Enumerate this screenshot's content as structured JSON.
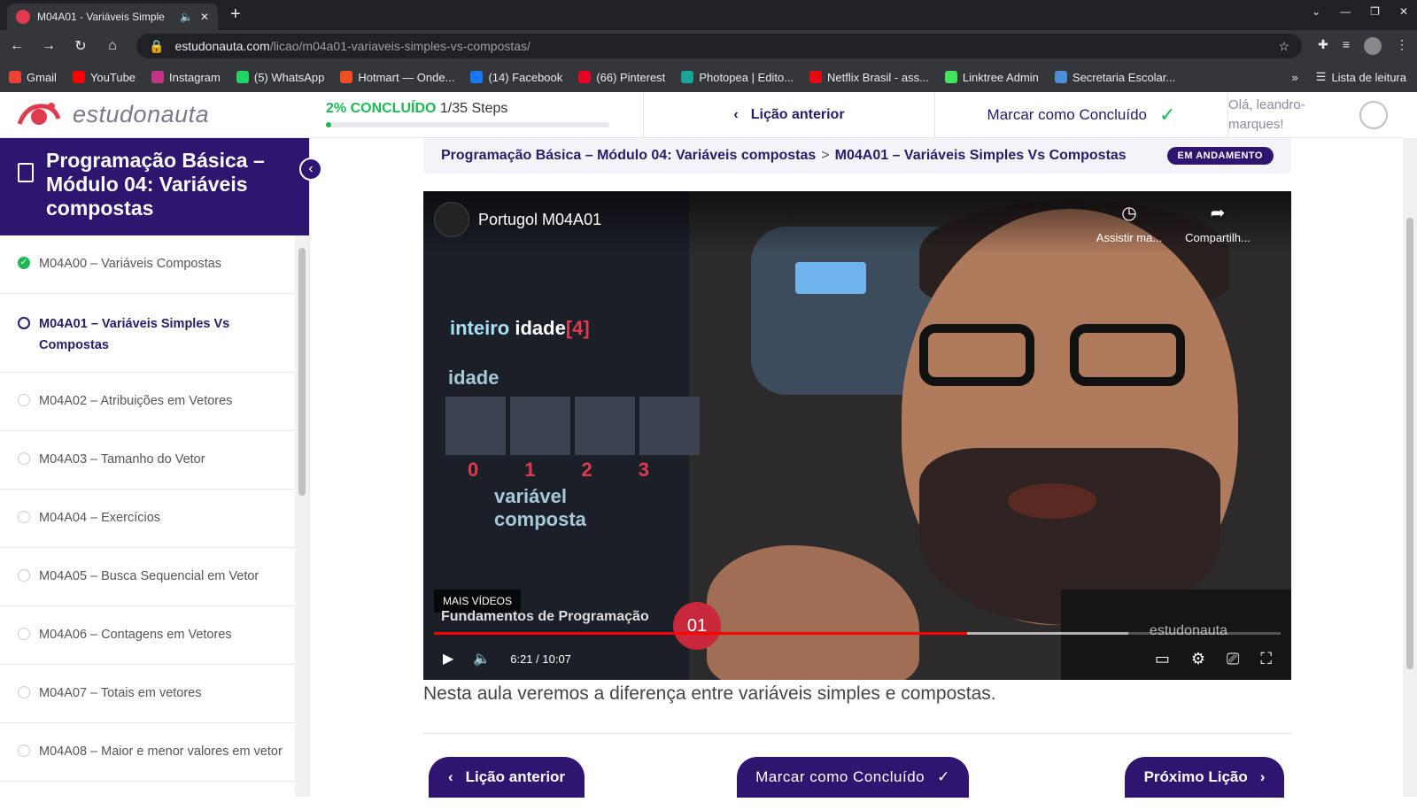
{
  "browser": {
    "tab_title": "M04A01 - Variáveis Simple",
    "url_host": "estudonauta.com",
    "url_path": "/licao/m04a01-variaveis-simples-vs-compostas/",
    "bookmarks": [
      {
        "label": "Gmail",
        "color": "#ea4335"
      },
      {
        "label": "YouTube",
        "color": "#ff0000"
      },
      {
        "label": "Instagram",
        "color": "#c13584"
      },
      {
        "label": "(5) WhatsApp",
        "color": "#25d366"
      },
      {
        "label": "Hotmart — Onde...",
        "color": "#f04e23"
      },
      {
        "label": "(14) Facebook",
        "color": "#1877f2"
      },
      {
        "label": "(66) Pinterest",
        "color": "#e60023"
      },
      {
        "label": "Photopea | Edito...",
        "color": "#18a497"
      },
      {
        "label": "Netflix Brasil - ass...",
        "color": "#e50914"
      },
      {
        "label": "Linktree Admin",
        "color": "#43e55e"
      },
      {
        "label": "Secretaria Escolar...",
        "color": "#4a8fd8"
      }
    ],
    "overflow": "»",
    "reading_list": "Lista de leitura"
  },
  "header": {
    "logo_text": "estudonauta",
    "progress_pct": "2% CONCLUÍDO",
    "progress_steps": "1/35 Steps",
    "progress_fraction": 0.02,
    "prev_label": "Lição anterior",
    "mark_label": "Marcar como Concluído",
    "greeting": "Olá, leandro-marques!"
  },
  "sidebar": {
    "course_title": "Programação Básica – Módulo 04: Variáveis compostas",
    "items": [
      {
        "label": "M04A00 – Variáveis Compostas"
      },
      {
        "label": "M04A01 – Variáveis Simples Vs Compostas"
      },
      {
        "label": "M04A02 – Atribuições em Vetores"
      },
      {
        "label": "M04A03 – Tamanho do Vetor"
      },
      {
        "label": "M04A04 – Exercícios"
      },
      {
        "label": "M04A05 – Busca Sequencial em Vetor"
      },
      {
        "label": "M04A06 – Contagens em Vetores"
      },
      {
        "label": "M04A07 – Totais em vetores"
      },
      {
        "label": "M04A08 – Maior e menor valores em vetor"
      }
    ]
  },
  "main": {
    "crumb_course": "Programação Básica – Módulo 04: Variáveis compostas",
    "crumb_sep": ">",
    "crumb_lesson": "M04A01 – Variáveis Simples Vs Compostas",
    "status_badge": "EM ANDAMENTO",
    "video": {
      "title": "Portugol M04A01",
      "watch_later": "Assistir ma...",
      "share": "Compartilh...",
      "code_type": "inteiro",
      "code_var": "idade",
      "code_index": "[4]",
      "array_label": "idade",
      "indices": [
        "0",
        "1",
        "2",
        "3"
      ],
      "composite_label_1": "variável",
      "composite_label_2": "composta",
      "more_videos": "MAIS VÍDEOS",
      "brand_overlay": "Fundamentos de Programação",
      "episode": "01",
      "watermark": "estudonauta",
      "time": "6:21 / 10:07",
      "played_fraction": 0.63,
      "buffered_fraction": 0.82
    },
    "description": "Nesta aula veremos a diferença entre variáveis simples e compostas.",
    "btn_prev": "Lição anterior",
    "btn_mark": "Marcar como Concluído",
    "btn_next": "Próximo Lição"
  }
}
